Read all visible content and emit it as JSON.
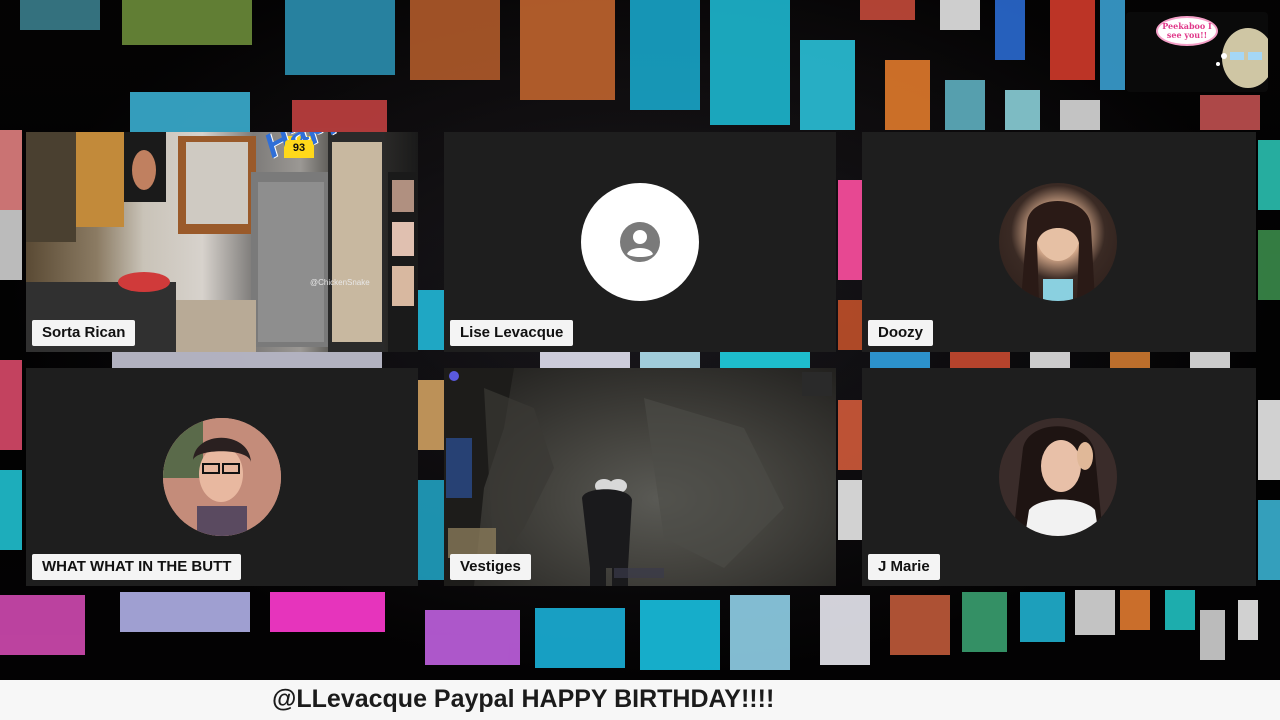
{
  "tiles": [
    {
      "label": "Sorta Rican",
      "kind": "video-kitchen",
      "overlay_text": "Happy B",
      "badge": "93",
      "handle": "@ChickenSnake"
    },
    {
      "label": "Lise Levacque",
      "kind": "default-avatar"
    },
    {
      "label": "Doozy",
      "kind": "photo-avatar"
    },
    {
      "label": "WHAT WHAT IN THE BUTT",
      "kind": "photo-avatar"
    },
    {
      "label": "Vestiges",
      "kind": "screen-share-game"
    },
    {
      "label": "J Marie",
      "kind": "photo-avatar"
    }
  ],
  "overlay": {
    "bubble_text": "Peekaboo I see you!!"
  },
  "ticker": {
    "text": "@LLevacque Paypal HAPPY BIRTHDAY!!!!"
  },
  "colors": {
    "tile_bg": "#1e1e1e",
    "label_bg": "#f4f4f4",
    "bottom_bar": "#f7f7f7",
    "bubble_accent": "#e0388a"
  },
  "icons": {
    "default_avatar": "user-circle-icon"
  }
}
